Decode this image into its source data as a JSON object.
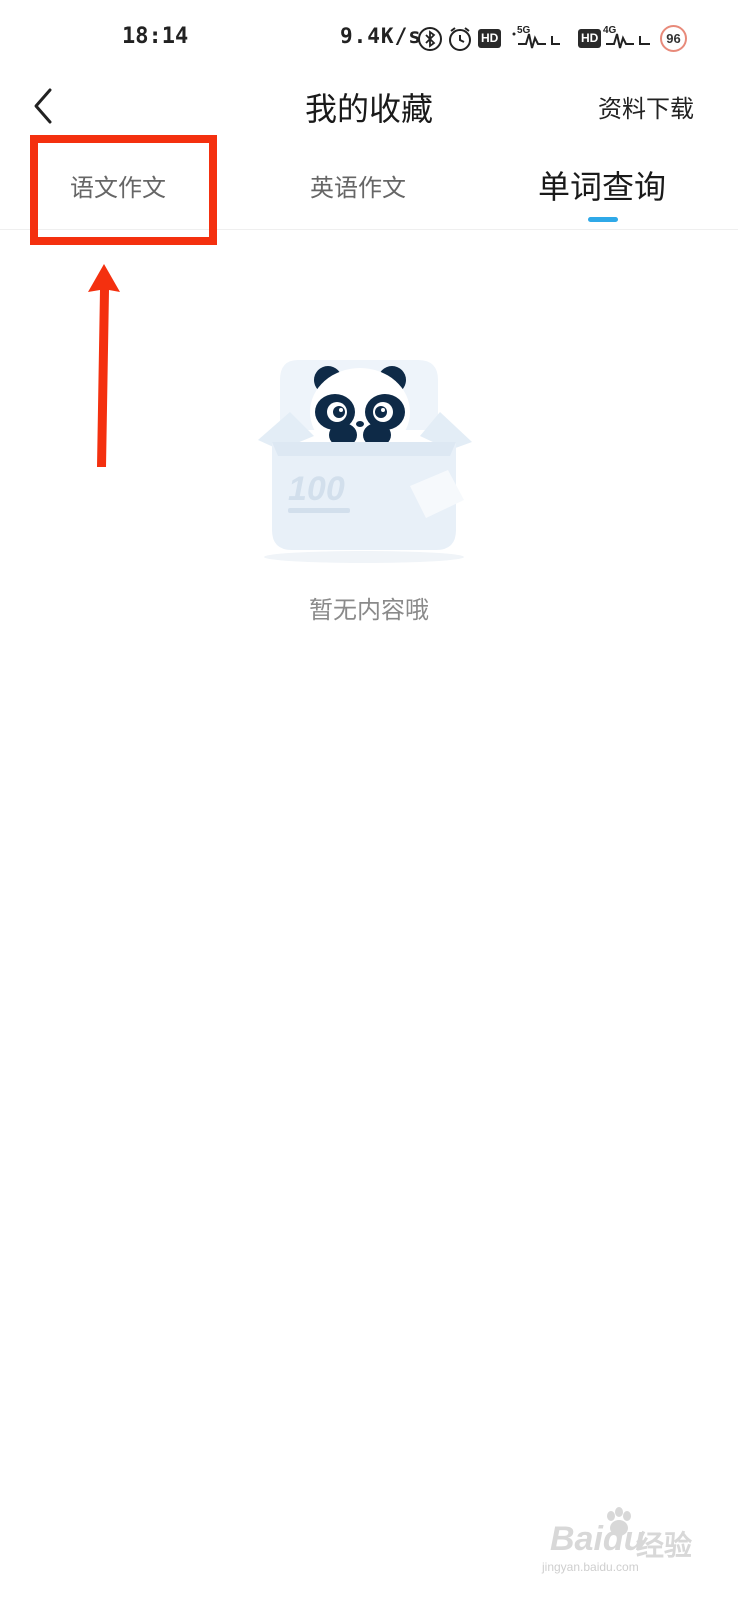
{
  "status_bar": {
    "time": "18:14",
    "network_speed": "9.4K/s",
    "hd_badge": "HD",
    "signal_1_label": "5G",
    "signal_2_label": "4G",
    "battery": "96",
    "icons": [
      "bluetooth-icon",
      "alarm-icon",
      "hd-icon",
      "signal-5g-icon",
      "hd-icon",
      "signal-4g-icon",
      "battery-icon"
    ]
  },
  "nav": {
    "back_icon": "chevron-left-icon",
    "title": "我的收藏",
    "right_link": "资料下载"
  },
  "tabs": [
    {
      "label": "语文作文",
      "active": false
    },
    {
      "label": "英语作文",
      "active": false
    },
    {
      "label": "单词查询",
      "active": true
    }
  ],
  "colors": {
    "tab_indicator": "#2fa9e8",
    "annotation": "#f4300f",
    "empty_text": "#8a8a8a"
  },
  "empty_state": {
    "illustration": "panda-in-box-illustration",
    "box_print": "100",
    "message": "暂无内容哦"
  },
  "watermark": {
    "logo": "Bai",
    "logo_tail": "du",
    "chinese": "经验",
    "url": "jingyan.baidu.com"
  }
}
